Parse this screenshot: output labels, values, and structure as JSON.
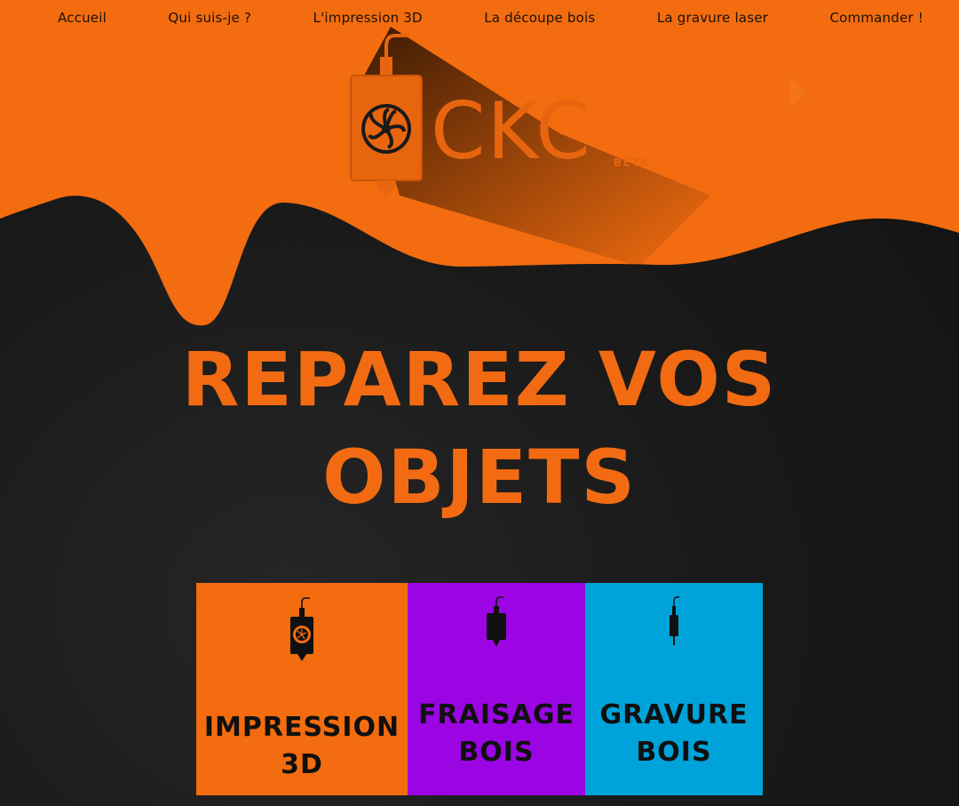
{
  "nav": {
    "items": [
      {
        "label": "Accueil"
      },
      {
        "label": "Qui suis-je ?"
      },
      {
        "label": "L'impression 3D"
      },
      {
        "label": "La découpe bois"
      },
      {
        "label": "La gravure laser"
      },
      {
        "label": "Commander !"
      }
    ]
  },
  "logo": {
    "text": "CKC",
    "badge": "BÊTA",
    "icon": "3d-printer-head-icon"
  },
  "hero": {
    "line1": "REPAREZ VOS",
    "line2": "OBJETS"
  },
  "cards": [
    {
      "line1": "IMPRESSION",
      "line2": "3D",
      "color": "#f36c0f",
      "icon": "printer-head-icon"
    },
    {
      "line1": "FRAISAGE",
      "line2": "BOIS",
      "color": "#9b05e3",
      "icon": "milling-head-icon"
    },
    {
      "line1": "GRAVURE",
      "line2": "BOIS",
      "color": "#00a3d9",
      "icon": "laser-head-icon"
    }
  ],
  "colors": {
    "accent": "#f26b12",
    "dark": "#1a1a1a",
    "purple": "#9b05e3",
    "blue": "#00a3d9"
  }
}
